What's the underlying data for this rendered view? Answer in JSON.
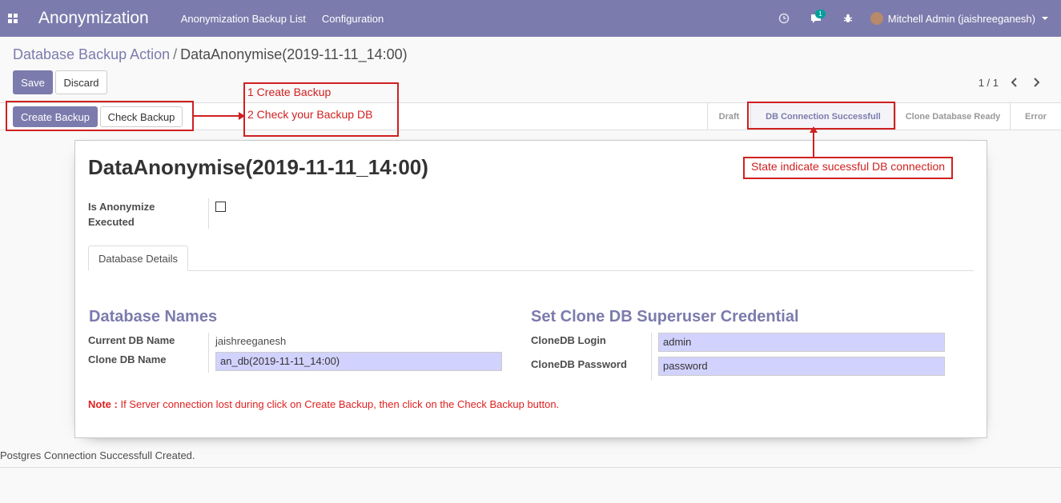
{
  "navbar": {
    "brand": "Anonymization",
    "menu": [
      "Anonymization Backup List",
      "Configuration"
    ],
    "chat_badge": "1",
    "user": "Mitchell Admin (jaishreeganesh)"
  },
  "breadcrumb": {
    "parent": "Database Backup Action",
    "separator": "/",
    "current": "DataAnonymise(2019-11-11_14:00)"
  },
  "buttons": {
    "save": "Save",
    "discard": "Discard",
    "create_backup": "Create Backup",
    "check_backup": "Check Backup"
  },
  "pager": {
    "value": "1 / 1"
  },
  "statusbar": {
    "stages": [
      "Draft",
      "DB Connection Successfull",
      "Clone Database Ready",
      "Error"
    ],
    "active": "DB Connection Successfull"
  },
  "form": {
    "title": "DataAnonymise(2019-11-11_14:00)",
    "is_anonymize_label_1": "Is Anonymize",
    "is_anonymize_label_2": "Executed",
    "is_anonymize_value": false,
    "tab": "Database Details",
    "db_names_title": "Database Names",
    "current_db_label": "Current DB Name",
    "current_db_value": "jaishreeganesh",
    "clone_db_label": "Clone DB Name",
    "clone_db_value": "an_db(2019-11-11_14:00)",
    "superuser_title": "Set Clone DB Superuser Credential",
    "clone_login_label": "CloneDB Login",
    "clone_login_value": "admin",
    "clone_password_label": "CloneDB Password",
    "clone_password_value": "password",
    "note_label": "Note :",
    "note_text": " If Server connection lost during click on Create Backup, then click on the Check Backup button."
  },
  "footer_message": "Postgres Connection Successfull Created.",
  "annotations": {
    "steps_1": "1 Create Backup",
    "steps_2": "2 Check your Backup DB",
    "state": "State indicate sucessful DB connection"
  },
  "colors": {
    "primary": "#7c7bad",
    "annotation": "#d02020",
    "input_bg": "#d2d2ff",
    "note": "#e02020"
  }
}
